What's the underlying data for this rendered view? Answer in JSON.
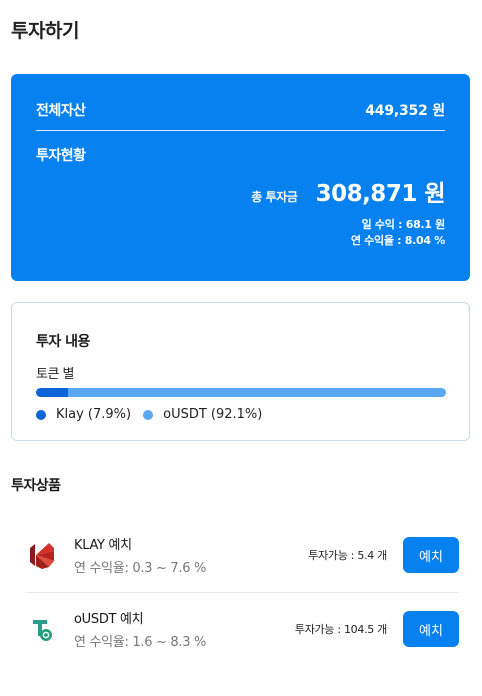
{
  "page": {
    "title": "투자하기"
  },
  "summary": {
    "total_assets_label": "전체자산",
    "total_assets_value": "449,352 원",
    "status_label": "투자현황",
    "total_invest_label": "총 투자금",
    "total_invest_value": "308,871 원",
    "daily_income": "일 수익 : 68.1 원",
    "annual_yield": "연 수익율 : 8.04 %"
  },
  "details": {
    "title": "투자 내용",
    "subtitle": "토큰 별",
    "allocation": [
      {
        "label": "Klay (7.9%)",
        "percent": 7.9,
        "color": "#0d64d8"
      },
      {
        "label": "oUSDT (92.1%)",
        "percent": 92.1,
        "color": "#5aa7f3"
      }
    ]
  },
  "products": {
    "title": "투자상품",
    "items": [
      {
        "name": "KLAY 예치",
        "yield": "연 수익율: 0.3 ~ 7.6 %",
        "available": "투자가능 : 5.4 개",
        "button": "예치",
        "icon": "klay-logo-icon"
      },
      {
        "name": "oUSDT 예치",
        "yield": "연 수익율: 1.6 ~ 8.3 %",
        "available": "투자가능 : 104.5 개",
        "button": "예치",
        "icon": "ousdt-logo-icon"
      }
    ]
  },
  "colors": {
    "primary": "#0780f0",
    "klay": "#0d64d8",
    "ousdt": "#5aa7f3"
  }
}
